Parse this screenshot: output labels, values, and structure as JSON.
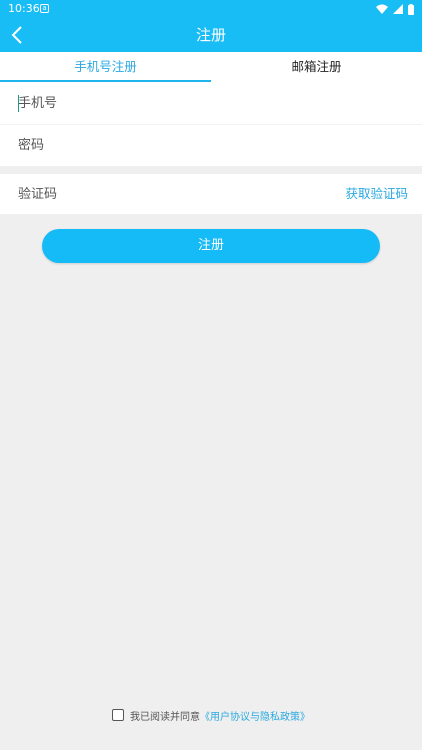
{
  "status_bar": {
    "time": "10:36",
    "notification_icon": "a"
  },
  "app_bar": {
    "title": "注册",
    "back_icon": "chevron-left-icon"
  },
  "tabs": [
    {
      "label": "手机号注册",
      "active": true
    },
    {
      "label": "邮箱注册",
      "active": false
    }
  ],
  "form": {
    "phone_placeholder": "手机号",
    "password_placeholder": "密码",
    "code_placeholder": "验证码",
    "get_code_label": "获取验证码",
    "submit_label": "注册"
  },
  "agreement": {
    "text": "我已阅读并同意",
    "link": "《用户协议与隐私政策》",
    "checked": false
  },
  "colors": {
    "primary": "#19bdf6",
    "link": "#2aa9e0",
    "background": "#efefef"
  }
}
